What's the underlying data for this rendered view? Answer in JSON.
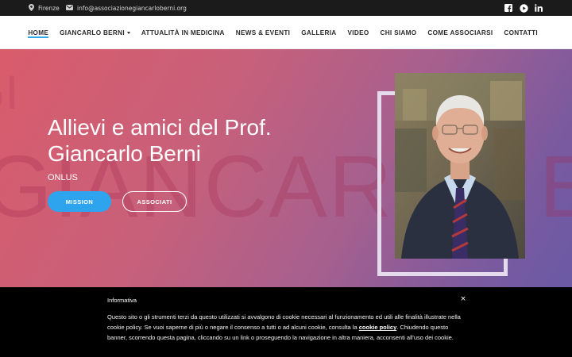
{
  "topbar": {
    "location": "Firenze",
    "email": "info@associazionegiancarloberni.org",
    "social": [
      "facebook-icon",
      "youtube-icon",
      "linkedin-icon"
    ]
  },
  "nav": {
    "items": [
      {
        "label": "HOME",
        "active": true
      },
      {
        "label": "GIANCARLO BERNI",
        "dropdown": true
      },
      {
        "label": "ATTUALITÀ IN MEDICINA"
      },
      {
        "label": "NEWS & EVENTI"
      },
      {
        "label": "GALLERIA"
      },
      {
        "label": "VIDEO"
      },
      {
        "label": "CHI SIAMO"
      },
      {
        "label": "COME ASSOCIARSI"
      },
      {
        "label": "CONTATTI"
      }
    ]
  },
  "hero": {
    "title": "Allievi e amici del Prof. Giancarlo Berni",
    "subtitle": "ONLUS",
    "bg_text": "GIANCARLO BE",
    "bg_text2": "GI",
    "buttons": {
      "mission": "MISSION",
      "associati": "ASSOCIATI"
    }
  },
  "cookie": {
    "title": "Informativa",
    "close": "×",
    "text_before": "Questo sito o gli strumenti terzi da questo utilizzati si avvalgono di cookie necessari al funzionamento ed utili alle finalità illustrate nella cookie policy. Se vuoi saperne di più o negare il consenso a tutti o ad alcuni cookie, consulta la ",
    "link": "cookie policy",
    "text_after": ". Chiudendo questo banner, scorrendo questa pagina, cliccando su un link o proseguendo la navigazione in altra maniera, acconsenti all'uso dei cookie."
  },
  "colors": {
    "accent": "#2fa7e8",
    "topbar_bg": "#1b1b1b",
    "hero_start": "#d95c6b",
    "hero_end": "#6a5aa6",
    "cookie_bg": "#000000"
  }
}
